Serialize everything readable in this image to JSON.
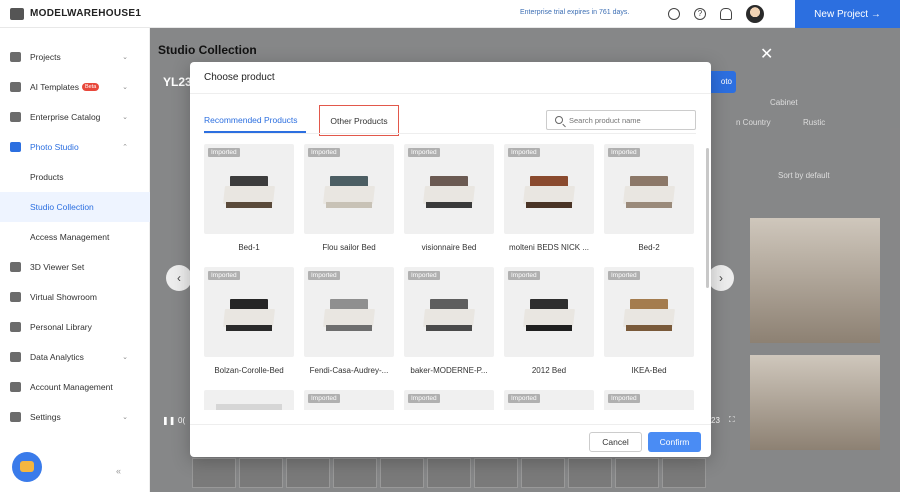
{
  "app": {
    "brand": "MODELWAREHOUSE1",
    "trial_notice": "Enterprise trial expires in 761 days.",
    "new_project_label": "New Project →"
  },
  "sidebar": {
    "items": [
      {
        "label": "Projects",
        "icon": "folder-icon",
        "chevron": "⌄"
      },
      {
        "label": "AI Templates",
        "icon": "ai-template-icon",
        "badge": "Beta",
        "chevron": "⌄"
      },
      {
        "label": "Enterprise Catalog",
        "icon": "catalog-icon",
        "chevron": "⌄"
      },
      {
        "label": "Photo Studio",
        "icon": "camera-icon",
        "chevron": "⌃"
      },
      {
        "label": "Products",
        "sub": true
      },
      {
        "label": "Studio Collection",
        "sub": true,
        "active": true
      },
      {
        "label": "Access Management",
        "sub": true
      },
      {
        "label": "3D Viewer Set",
        "icon": "cube-icon"
      },
      {
        "label": "Virtual Showroom",
        "icon": "showroom-icon"
      },
      {
        "label": "Personal Library",
        "icon": "library-icon"
      },
      {
        "label": "Data Analytics",
        "icon": "analytics-icon",
        "chevron": "⌄"
      },
      {
        "label": "Account Management",
        "icon": "account-icon"
      },
      {
        "label": "Settings",
        "icon": "gear-icon",
        "chevron": "⌄"
      }
    ],
    "collapse_label": "«"
  },
  "background": {
    "page_title": "Studio Collection",
    "viewer_title": "YL23",
    "photo_button_label": "oto",
    "filters": [
      "Cabinet",
      "n Country",
      "Rustic"
    ],
    "sort_label": "Sort by default",
    "video_time": "23",
    "video_time_left": "0("
  },
  "modal": {
    "title": "Choose product",
    "tabs": [
      {
        "label": "Recommended Products",
        "active": true
      },
      {
        "label": "Other Products",
        "active": false
      }
    ],
    "search": {
      "placeholder": "Search product name",
      "value": ""
    },
    "badge_label": "Imported",
    "products": [
      {
        "name": "Bed-1",
        "head": "#3d3d3d",
        "base": "#5a4a3a"
      },
      {
        "name": "Flou sailor Bed",
        "head": "#4c5e63",
        "base": "#c8c2b6"
      },
      {
        "name": "visionnaire Bed",
        "head": "#6b5a52",
        "base": "#3a3a3a"
      },
      {
        "name": "molteni BEDS NICK ...",
        "head": "#8a4a2e",
        "base": "#4a3426"
      },
      {
        "name": "Bed-2",
        "head": "#8c7868",
        "base": "#9a8a7a"
      },
      {
        "name": "Bolzan-Corolle-Bed",
        "head": "#262626",
        "base": "#2a2a2a"
      },
      {
        "name": "Fendi-Casa-Audrey-...",
        "head": "#8f8f8f",
        "base": "#6e6e6e"
      },
      {
        "name": "baker-MODERNE-P...",
        "head": "#5e5e5e",
        "base": "#4a4a4a"
      },
      {
        "name": "2012 Bed",
        "head": "#2e2e2e",
        "base": "#1f1f1f"
      },
      {
        "name": "IKEA-Bed",
        "head": "#a47c4e",
        "base": "#7a5a3a"
      }
    ],
    "partial_row_badges": [
      "",
      "Imported",
      "Imported",
      "Imported",
      "Imported"
    ],
    "cancel_label": "Cancel",
    "confirm_label": "Confirm"
  }
}
